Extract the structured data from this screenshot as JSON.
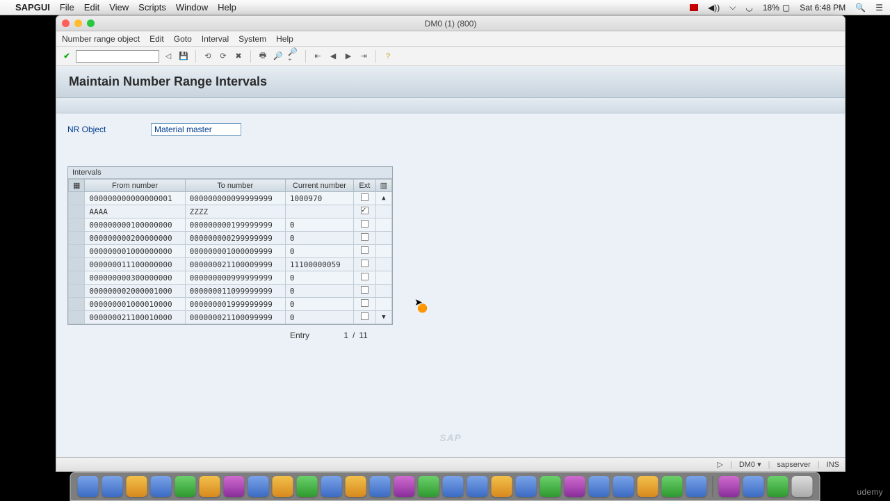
{
  "mac_menu": {
    "app": "SAPGUI",
    "items": [
      "File",
      "Edit",
      "View",
      "Scripts",
      "Window",
      "Help"
    ],
    "battery_pct": "18%",
    "clock": "Sat 6:48 PM"
  },
  "window": {
    "title": "DM0 (1) (800)",
    "app_menu": [
      "Number range object",
      "Edit",
      "Goto",
      "Interval",
      "System",
      "Help"
    ]
  },
  "page": {
    "title": "Maintain Number Range Intervals",
    "nr_label": "NR Object",
    "nr_value": "Material master"
  },
  "table": {
    "title": "Intervals",
    "columns": [
      "From number",
      "To number",
      "Current number",
      "Ext"
    ],
    "rows": [
      {
        "from": "000000000000000001",
        "to": "000000000099999999",
        "cur": "1000970",
        "ext": false
      },
      {
        "from": "AAAA",
        "to": "ZZZZ",
        "cur": "",
        "ext": true
      },
      {
        "from": "000000000100000000",
        "to": "000000000199999999",
        "cur": "0",
        "ext": false
      },
      {
        "from": "000000000200000000",
        "to": "000000000299999999",
        "cur": "0",
        "ext": false
      },
      {
        "from": "000000001000000000",
        "to": "000000001000009999",
        "cur": "0",
        "ext": false
      },
      {
        "from": "000000011100000000",
        "to": "000000021100009999",
        "cur": "11100000059",
        "ext": false
      },
      {
        "from": "000000000300000000",
        "to": "000000000999999999",
        "cur": "0",
        "ext": false
      },
      {
        "from": "000000002000001000",
        "to": "000000011099999999",
        "cur": "0",
        "ext": false
      },
      {
        "from": "000000001000010000",
        "to": "000000001999999999",
        "cur": "0",
        "ext": false
      },
      {
        "from": "000000021100010000",
        "to": "000000021100099999",
        "cur": "0",
        "ext": false
      }
    ],
    "entry_label": "Entry",
    "entry_current": "1",
    "entry_sep": "/",
    "entry_total": "11"
  },
  "status": {
    "system": "DM0",
    "server": "sapserver",
    "mode": "INS"
  },
  "udemy": "udemy"
}
